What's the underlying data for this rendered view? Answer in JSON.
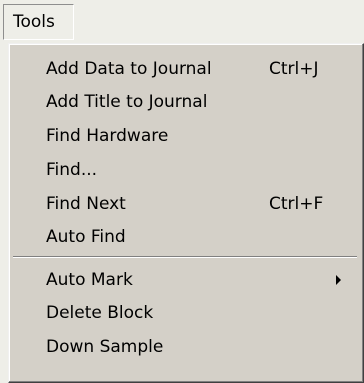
{
  "menubar": {
    "menu_title": "Tools"
  },
  "menu": {
    "group1": [
      {
        "label": "Add Data to Journal",
        "shortcut": "Ctrl+J"
      },
      {
        "label": "Add Title to Journal",
        "shortcut": ""
      },
      {
        "label": "Find Hardware",
        "shortcut": ""
      },
      {
        "label": "Find...",
        "shortcut": ""
      },
      {
        "label": "Find Next",
        "shortcut": "Ctrl+F"
      },
      {
        "label": "Auto Find",
        "shortcut": ""
      }
    ],
    "group2": [
      {
        "label": "Auto Mark",
        "submenu_icon": "submenu-arrow-icon"
      },
      {
        "label": "Delete Block"
      },
      {
        "label": "Down Sample"
      }
    ]
  }
}
